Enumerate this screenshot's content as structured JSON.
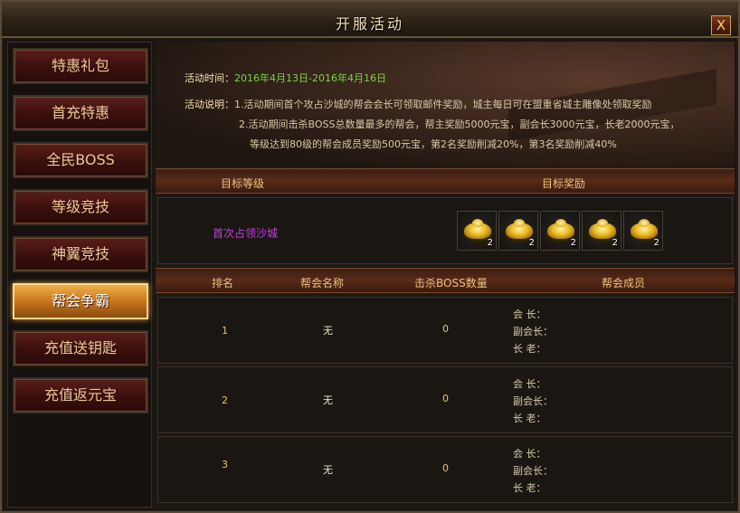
{
  "window": {
    "title": "开服活动",
    "close_label": "X"
  },
  "sidebar": {
    "items": [
      {
        "label": "特惠礼包",
        "active": false
      },
      {
        "label": "首充特惠",
        "active": false
      },
      {
        "label": "全民BOSS",
        "active": false
      },
      {
        "label": "等级竞技",
        "active": false
      },
      {
        "label": "神翼竞技",
        "active": false
      },
      {
        "label": "帮会争霸",
        "active": true
      },
      {
        "label": "充值送钥匙",
        "active": false
      },
      {
        "label": "充值返元宝",
        "active": false
      }
    ]
  },
  "info": {
    "time_label": "活动时间：",
    "time_value": "2016年4月13日-2016年4月16日",
    "desc_label": "活动说明：",
    "desc_line1": "1.活动期间首个攻占沙城的帮会会长可领取邮件奖励，城主每日可在盟重省城主雕像处领取奖励",
    "desc_line2": "2.活动期间击杀BOSS总数量最多的帮会，帮主奖励5000元宝，副会长3000元宝，长老2000元宝，",
    "desc_line3": "等级达到80级的帮会成员奖励500元宝，第2名奖励削减20%，第3名奖励削减40%"
  },
  "reward_table": {
    "col_level": "目标等级",
    "col_reward": "目标奖励",
    "row_label": "首次占领沙城",
    "items": [
      {
        "icon": "gold-ingot-icon",
        "count": "2"
      },
      {
        "icon": "gold-ingot-icon",
        "count": "2"
      },
      {
        "icon": "gold-ingot-icon",
        "count": "2"
      },
      {
        "icon": "gold-ingot-icon",
        "count": "2"
      },
      {
        "icon": "gold-ingot-icon",
        "count": "2"
      }
    ]
  },
  "rank_table": {
    "col_rank": "排名",
    "col_guild": "帮会名称",
    "col_kills": "击杀BOSS数量",
    "col_members": "帮会成员",
    "member_labels": {
      "leader": "会 长：",
      "vice": "副会长：",
      "elder": "长 老："
    },
    "rows": [
      {
        "rank": "1",
        "guild": "无",
        "kills": "0"
      },
      {
        "rank": "2",
        "guild": "无",
        "kills": "0"
      },
      {
        "rank": "3",
        "guild": "无",
        "kills": "0"
      }
    ]
  },
  "colors": {
    "accent": "#e8c27a",
    "time_green": "#7cd44a",
    "reward_purple": "#c040e0",
    "active_tab": "#f0b04a"
  }
}
